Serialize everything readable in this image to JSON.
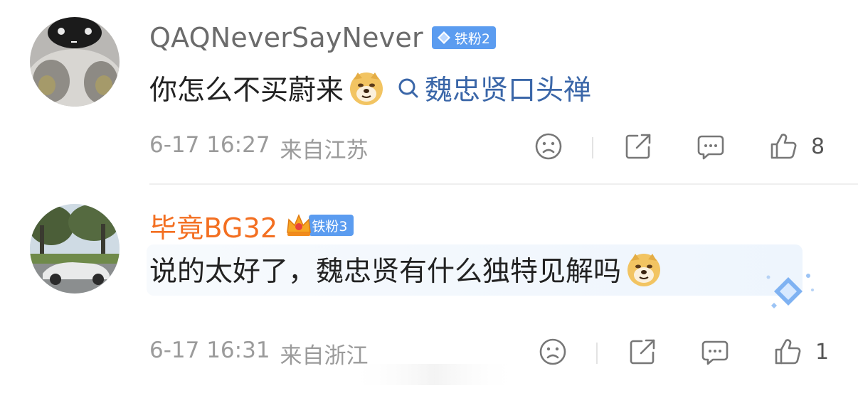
{
  "comments": [
    {
      "username": "QAQNeverSayNever",
      "badge": "铁粉2",
      "text": "你怎么不买蔚来",
      "emoji": "doge-emoji",
      "topic": "魏忠贤口头禅",
      "date": "6-17 16:27",
      "location": "来自江苏",
      "likes": "8"
    },
    {
      "username": "毕竟BG32",
      "badge": "铁粉3",
      "text": "说的太好了，魏忠贤有什么独特见解吗",
      "emoji": "doge-emoji",
      "date": "6-17 16:31",
      "location": "来自浙江",
      "likes": "1"
    }
  ],
  "colors": {
    "username_default": "#6b6b6b",
    "username_highlight": "#f36f21",
    "badge": "#5b9cf0",
    "topic_link": "#3a66a8",
    "meta": "#9b9b9b"
  },
  "icons": [
    "dislike-icon",
    "share-icon",
    "comment-icon",
    "like-icon",
    "search-icon",
    "crown-icon",
    "diamond-icon"
  ]
}
